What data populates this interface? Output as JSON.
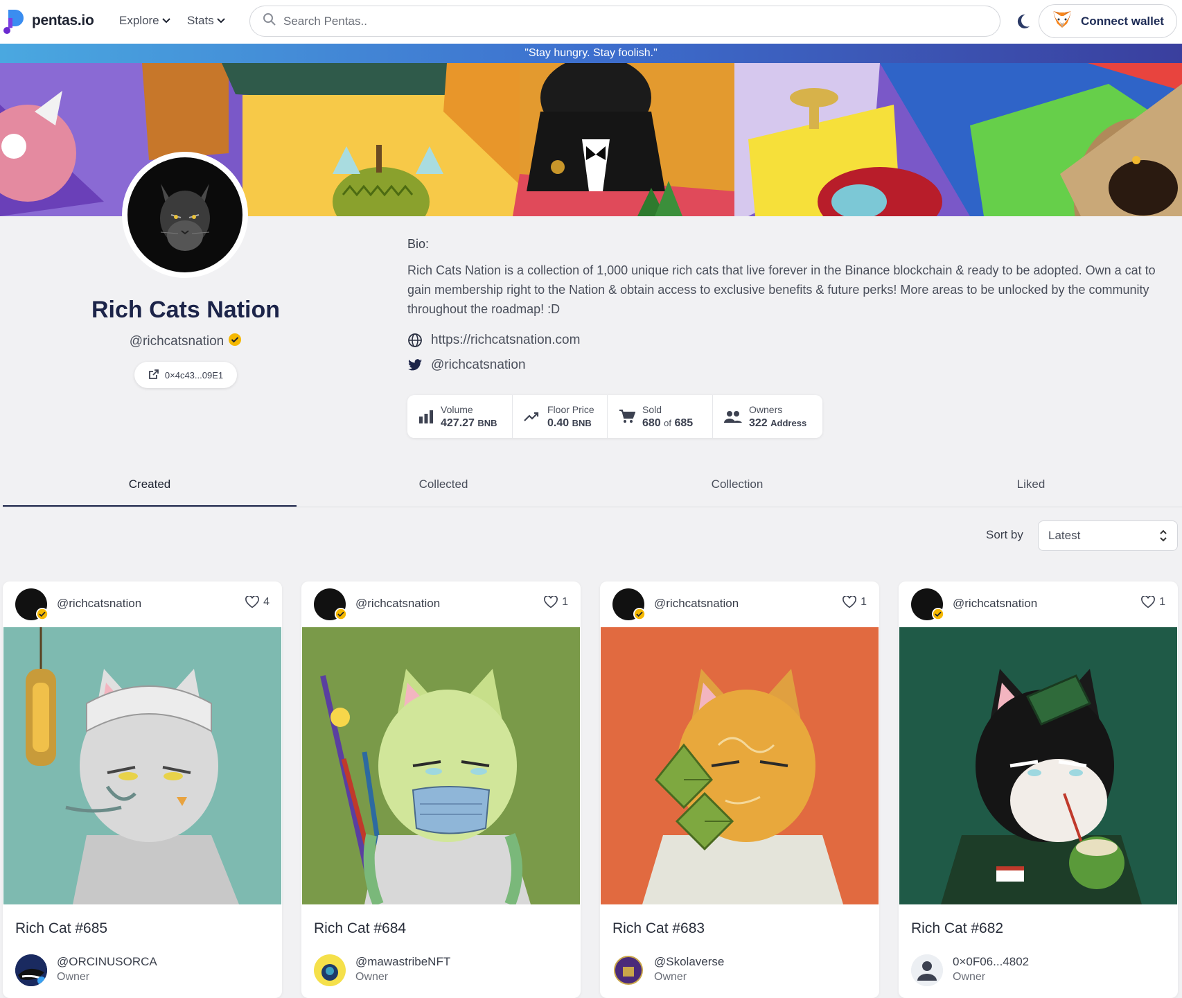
{
  "app": {
    "logo_text": "pentas.io"
  },
  "nav": {
    "explore": "Explore",
    "stats": "Stats",
    "search_placeholder": "Search Pentas..",
    "connect_label": "Connect wallet"
  },
  "banner": {
    "quote": "\"Stay hungry. Stay foolish.\""
  },
  "profile": {
    "name": "Rich Cats Nation",
    "handle": "@richcatsnation",
    "address": "0×4c43...09E1",
    "bio_label": "Bio:",
    "bio": "Rich Cats Nation is a collection of 1,000 unique rich cats that live forever in the Binance blockchain & ready to be adopted. Own a cat to gain membership right to the Nation & obtain access to exclusive benefits & future perks! More areas to be unlocked by the community throughout the roadmap! :D",
    "website": "https://richcatsnation.com",
    "twitter": "@richcatsnation"
  },
  "stats": {
    "volume_label": "Volume",
    "volume_value": "427.27",
    "volume_unit": "BNB",
    "floor_label": "Floor Price",
    "floor_value": "0.40",
    "floor_unit": "BNB",
    "sold_label": "Sold",
    "sold_value": "680",
    "sold_of": "of",
    "sold_total": "685",
    "owners_label": "Owners",
    "owners_value": "322",
    "owners_unit": "Address"
  },
  "tabs": [
    "Created",
    "Collected",
    "Collection",
    "Liked"
  ],
  "sort": {
    "label": "Sort by",
    "value": "Latest"
  },
  "cards": [
    {
      "creator": "@richcatsnation",
      "likes": "4",
      "title": "Rich Cat #685",
      "owner": "@ORCINUSORCA",
      "role": "Owner",
      "bg": "#7ebab0"
    },
    {
      "creator": "@richcatsnation",
      "likes": "1",
      "title": "Rich Cat #684",
      "owner": "@mawastribeNFT",
      "role": "Owner",
      "bg": "#7a9a49"
    },
    {
      "creator": "@richcatsnation",
      "likes": "1",
      "title": "Rich Cat #683",
      "owner": "@Skolaverse",
      "role": "Owner",
      "bg": "#e16a40"
    },
    {
      "creator": "@richcatsnation",
      "likes": "1",
      "title": "Rich Cat #682",
      "owner": "0×0F06...4802",
      "role": "Owner",
      "bg": "#1f5a47"
    }
  ],
  "colors": {
    "accent": "#1c2449",
    "verified": "#f5b800"
  },
  "icons": [
    "search-icon",
    "moon-icon",
    "metamask-fox-icon",
    "globe-icon",
    "twitter-icon",
    "external-link-icon",
    "bar-chart-icon",
    "trending-up-icon",
    "cart-icon",
    "people-icon",
    "heart-icon",
    "chevron-down-icon",
    "updown-icon",
    "verified-badge-icon"
  ]
}
